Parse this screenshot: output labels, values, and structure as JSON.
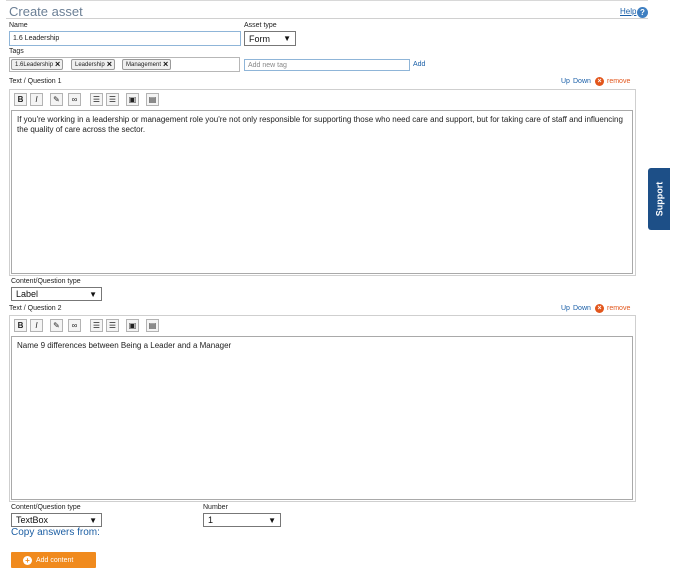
{
  "header": {
    "title": "Create asset",
    "help_label": "Help",
    "help_icon": "question-circle-icon"
  },
  "form": {
    "name_label": "Name",
    "name_value": "1.6 Leadership",
    "asset_type_label": "Asset type",
    "asset_type_value": "Form",
    "tags_label": "Tags",
    "tags": [
      "1.6Leadership",
      "Leadership",
      "Management"
    ],
    "new_tag_placeholder": "Add new tag",
    "add_tag_label": "Add"
  },
  "questions": [
    {
      "label": "Text / Question 1",
      "up_label": "Up",
      "down_label": "Down",
      "remove_label": "remove",
      "text": "If you're working in a leadership or management role you're not only responsible for supporting those who need care and support, but for taking care of staff and influencing the quality of care across the sector.",
      "type_label": "Content/Question type",
      "type_value": "Label"
    },
    {
      "label": "Text / Question 2",
      "up_label": "Up",
      "down_label": "Down",
      "remove_label": "remove",
      "text": "Name 9 differences between Being a Leader and a Manager",
      "type_label": "Content/Question type",
      "type_value": "TextBox",
      "number_label": "Number",
      "number_value": "1"
    }
  ],
  "toolbar_buttons": [
    "B",
    "I"
  ],
  "copy_answers_label": "Copy answers from:",
  "add_content_label": "Add content",
  "support_tab_label": "Support",
  "colors": {
    "accent_orange": "#f08a1d",
    "link_blue": "#1a5fa8",
    "remove_red": "#e2561c",
    "support_navy": "#1d4f87"
  }
}
